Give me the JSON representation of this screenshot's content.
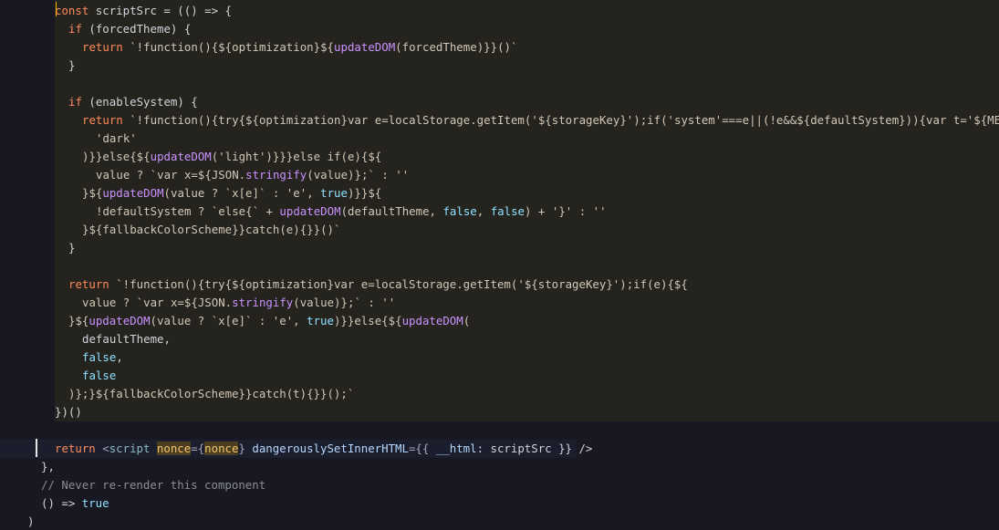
{
  "editor": {
    "lines": [
      {
        "indent": 60,
        "tokens": [
          {
            "text": "const",
            "cls": "tok-keyword"
          },
          {
            "text": " scriptSrc = (() => {",
            "cls": "tok-text"
          }
        ]
      },
      {
        "indent": 75,
        "tokens": [
          {
            "text": "if",
            "cls": "tok-keyword"
          },
          {
            "text": " (forcedTheme) {",
            "cls": "tok-text"
          }
        ]
      },
      {
        "indent": 90,
        "tokens": [
          {
            "text": "return",
            "cls": "tok-keyword"
          },
          {
            "text": " `!function(){${optimization}${",
            "cls": "tok-string"
          },
          {
            "text": "updateDOM",
            "cls": "tok-fn"
          },
          {
            "text": "(forcedTheme)}}()`",
            "cls": "tok-string"
          }
        ]
      },
      {
        "indent": 75,
        "tokens": [
          {
            "text": "}",
            "cls": "tok-text"
          }
        ]
      },
      {
        "indent": 75,
        "tokens": []
      },
      {
        "indent": 75,
        "tokens": [
          {
            "text": "if",
            "cls": "tok-keyword"
          },
          {
            "text": " (enableSystem) {",
            "cls": "tok-text"
          }
        ]
      },
      {
        "indent": 90,
        "tokens": [
          {
            "text": "return",
            "cls": "tok-keyword"
          },
          {
            "text": " `!function(){try{${optimization}var e=localStorage.getItem('${storageKey}');if('system'===e||(!e&&${defaultSystem})){var t='${MEDIA}',m=",
            "cls": "tok-string"
          }
        ]
      },
      {
        "indent": 105,
        "tokens": [
          {
            "text": "'dark'",
            "cls": "tok-string"
          }
        ]
      },
      {
        "indent": 90,
        "tokens": [
          {
            "text": ")}}else{${",
            "cls": "tok-string"
          },
          {
            "text": "updateDOM",
            "cls": "tok-fn"
          },
          {
            "text": "('light')}}}else if(e){${",
            "cls": "tok-string"
          }
        ]
      },
      {
        "indent": 105,
        "tokens": [
          {
            "text": "value ? `var x=${JSON.",
            "cls": "tok-string"
          },
          {
            "text": "stringify",
            "cls": "tok-fn"
          },
          {
            "text": "(value)};` : ''",
            "cls": "tok-string"
          }
        ]
      },
      {
        "indent": 90,
        "tokens": [
          {
            "text": "}${",
            "cls": "tok-string"
          },
          {
            "text": "updateDOM",
            "cls": "tok-fn"
          },
          {
            "text": "(value ? `x[e]` : 'e', ",
            "cls": "tok-string"
          },
          {
            "text": "true",
            "cls": "tok-bool"
          },
          {
            "text": ")}}${",
            "cls": "tok-string"
          }
        ]
      },
      {
        "indent": 105,
        "tokens": [
          {
            "text": "!defaultSystem ? `else{` + ",
            "cls": "tok-string"
          },
          {
            "text": "updateDOM",
            "cls": "tok-fn"
          },
          {
            "text": "(defaultTheme, ",
            "cls": "tok-string"
          },
          {
            "text": "false",
            "cls": "tok-bool"
          },
          {
            "text": ", ",
            "cls": "tok-string"
          },
          {
            "text": "false",
            "cls": "tok-bool"
          },
          {
            "text": ") + '}' : ''",
            "cls": "tok-string"
          }
        ]
      },
      {
        "indent": 90,
        "tokens": [
          {
            "text": "}${fallbackColorScheme}}catch(e){}}()`",
            "cls": "tok-string"
          }
        ]
      },
      {
        "indent": 75,
        "tokens": [
          {
            "text": "}",
            "cls": "tok-text"
          }
        ]
      },
      {
        "indent": 75,
        "tokens": []
      },
      {
        "indent": 75,
        "tokens": [
          {
            "text": "return",
            "cls": "tok-keyword"
          },
          {
            "text": " `!function(){try{${optimization}var e=localStorage.getItem('${storageKey}');if(e){${",
            "cls": "tok-string"
          }
        ]
      },
      {
        "indent": 90,
        "tokens": [
          {
            "text": "value ? `var x=${JSON.",
            "cls": "tok-string"
          },
          {
            "text": "stringify",
            "cls": "tok-fn"
          },
          {
            "text": "(value)};` : ''",
            "cls": "tok-string"
          }
        ]
      },
      {
        "indent": 75,
        "tokens": [
          {
            "text": "}${",
            "cls": "tok-string"
          },
          {
            "text": "updateDOM",
            "cls": "tok-fn"
          },
          {
            "text": "(value ? `x[e]` : 'e', ",
            "cls": "tok-string"
          },
          {
            "text": "true",
            "cls": "tok-bool"
          },
          {
            "text": ")}}else{${",
            "cls": "tok-string"
          },
          {
            "text": "updateDOM",
            "cls": "tok-fn"
          },
          {
            "text": "(",
            "cls": "tok-string"
          }
        ]
      },
      {
        "indent": 90,
        "tokens": [
          {
            "text": "defaultTheme,",
            "cls": "tok-text"
          }
        ]
      },
      {
        "indent": 90,
        "tokens": [
          {
            "text": "false",
            "cls": "tok-bool"
          },
          {
            "text": ",",
            "cls": "tok-text"
          }
        ]
      },
      {
        "indent": 90,
        "tokens": [
          {
            "text": "false",
            "cls": "tok-bool"
          }
        ]
      },
      {
        "indent": 75,
        "tokens": [
          {
            "text": ")};}${fallbackColorScheme}}catch(t){}}();`",
            "cls": "tok-string"
          }
        ]
      },
      {
        "indent": 60,
        "tokens": [
          {
            "text": "})()",
            "cls": "tok-text"
          }
        ]
      },
      {
        "indent": 60,
        "tokens": []
      },
      {
        "indent": 60,
        "current": true,
        "tokens": [
          {
            "text": "return",
            "cls": "tok-keyword"
          },
          {
            "text": " <",
            "cls": "tok-punct"
          },
          {
            "text": "script",
            "cls": "tok-jsx"
          },
          {
            "text": " ",
            "cls": "tok-text"
          },
          {
            "text": "nonce",
            "cls": "tok-nonce"
          },
          {
            "text": "={",
            "cls": "tok-punct"
          },
          {
            "text": "nonce",
            "cls": "tok-nonce"
          },
          {
            "text": "} ",
            "cls": "tok-punct"
          },
          {
            "text": "dangerouslySetInnerHTML",
            "cls": "tok-attr"
          },
          {
            "text": "={{ ",
            "cls": "tok-punct"
          },
          {
            "text": "__html",
            "cls": "tok-attr"
          },
          {
            "text": ": scriptSrc }} />",
            "cls": "tok-text"
          }
        ]
      },
      {
        "indent": 45,
        "tokens": [
          {
            "text": "},",
            "cls": "tok-text"
          }
        ]
      },
      {
        "indent": 45,
        "tokens": [
          {
            "text": "// Never re-render this component",
            "cls": "tok-comment"
          }
        ]
      },
      {
        "indent": 45,
        "tokens": [
          {
            "text": "() => ",
            "cls": "tok-text"
          },
          {
            "text": "true",
            "cls": "tok-bool"
          }
        ]
      },
      {
        "indent": 30,
        "tokens": [
          {
            "text": ")",
            "cls": "tok-text"
          }
        ]
      }
    ]
  }
}
